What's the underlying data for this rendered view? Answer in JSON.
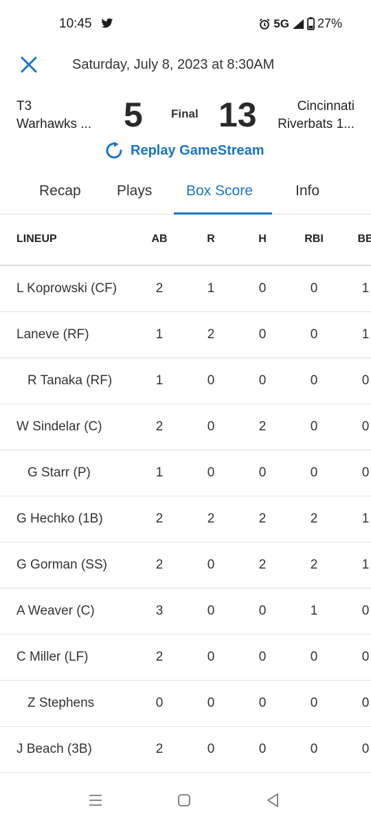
{
  "status": {
    "time": "10:45",
    "network": "5G",
    "battery": "27%"
  },
  "header": {
    "date": "Saturday, July 8, 2023 at 8:30AM"
  },
  "game": {
    "team_left_line1": "T3",
    "team_left_line2": "Warhawks ...",
    "score_left": "5",
    "status": "Final",
    "score_right": "13",
    "team_right_line1": "Cincinnati",
    "team_right_line2": "Riverbats 1..."
  },
  "replay": {
    "label": "Replay GameStream"
  },
  "tabs": [
    {
      "label": "Recap"
    },
    {
      "label": "Plays"
    },
    {
      "label": "Box Score"
    },
    {
      "label": "Info"
    }
  ],
  "table": {
    "columns": [
      "LINEUP",
      "AB",
      "R",
      "H",
      "RBI",
      "BB"
    ],
    "rows": [
      {
        "name": "L Koprowski (CF)",
        "sub": false,
        "ab": "2",
        "r": "1",
        "h": "0",
        "rbi": "0",
        "bb": "1"
      },
      {
        "name": "Laneve (RF)",
        "sub": false,
        "ab": "1",
        "r": "2",
        "h": "0",
        "rbi": "0",
        "bb": "1"
      },
      {
        "name": "R Tanaka (RF)",
        "sub": true,
        "ab": "1",
        "r": "0",
        "h": "0",
        "rbi": "0",
        "bb": "0"
      },
      {
        "name": "W Sindelar (C)",
        "sub": false,
        "ab": "2",
        "r": "0",
        "h": "2",
        "rbi": "0",
        "bb": "0"
      },
      {
        "name": "G Starr (P)",
        "sub": true,
        "ab": "1",
        "r": "0",
        "h": "0",
        "rbi": "0",
        "bb": "0"
      },
      {
        "name": "G Hechko (1B)",
        "sub": false,
        "ab": "2",
        "r": "2",
        "h": "2",
        "rbi": "2",
        "bb": "1"
      },
      {
        "name": "G Gorman (SS)",
        "sub": false,
        "ab": "2",
        "r": "0",
        "h": "2",
        "rbi": "2",
        "bb": "1"
      },
      {
        "name": "A Weaver (C)",
        "sub": false,
        "ab": "3",
        "r": "0",
        "h": "0",
        "rbi": "1",
        "bb": "0"
      },
      {
        "name": "C Miller (LF)",
        "sub": false,
        "ab": "2",
        "r": "0",
        "h": "0",
        "rbi": "0",
        "bb": "0"
      },
      {
        "name": "Z Stephens",
        "sub": true,
        "ab": "0",
        "r": "0",
        "h": "0",
        "rbi": "0",
        "bb": "0"
      },
      {
        "name": "J Beach (3B)",
        "sub": false,
        "ab": "2",
        "r": "0",
        "h": "0",
        "rbi": "0",
        "bb": "0"
      }
    ]
  },
  "colors": {
    "accent": "#1a74c4",
    "text": "#222222"
  }
}
